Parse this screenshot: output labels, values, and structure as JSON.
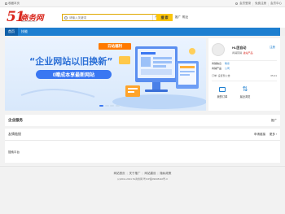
{
  "topbar": {
    "home_label": "收藏本页",
    "right_links": [
      "会员登录",
      "免费注册",
      "会员中心"
    ]
  },
  "header": {
    "logo_num": "51",
    "logo_text": "商务网",
    "logo_url": "www.51sole.com",
    "search_placeholder": "请输入关键词",
    "search_category": "产品",
    "search_button": "搜 索",
    "hot_links": [
      "推广",
      "附近"
    ]
  },
  "nav": {
    "items": [
      "首页",
      "技能"
    ]
  },
  "banner": {
    "ribbon": "云站福利",
    "headline": "“企业网站以旧换新”",
    "pill": "0赠成本享最新网站",
    "slides": 4,
    "active_slide": 0
  },
  "profile": {
    "name": "HL团自动",
    "register": "注册",
    "sub_text": "商铺营销",
    "sub_link": "进站产品",
    "row1": [
      "商铺信息",
      "联系"
    ],
    "row2": [
      "商铺产品",
      "公司"
    ],
    "notice_left": "订单: 设置暂公告",
    "notice_right": "05-31",
    "actions": [
      "我的订单",
      "最近浏览"
    ]
  },
  "service": {
    "title": "企业服务",
    "more": "推广"
  },
  "links": {
    "title": "友情链接",
    "more_left": "申请链接",
    "more_right": "更多 ›",
    "item": "搜索平台"
  },
  "footer": {
    "links": [
      "网站首页",
      "关于推广",
      "网站建设",
      "隐私政策"
    ],
    "copyright": "(c)2011-2021 51商务网 粤ICP备09038110号-3"
  }
}
